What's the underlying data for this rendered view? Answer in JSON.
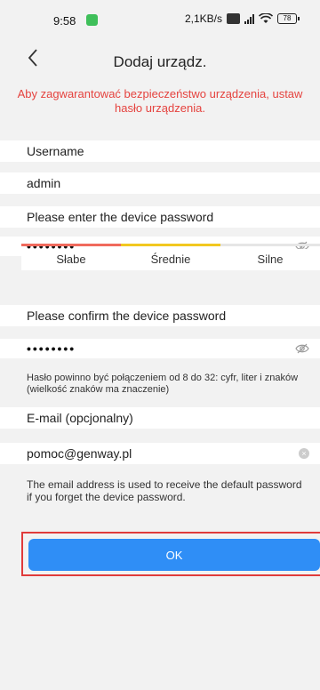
{
  "status_bar": {
    "time": "9:58",
    "network_speed": "2,1KB/s",
    "battery": "78"
  },
  "header": {
    "back_icon": "chevron-left-icon",
    "title": "Dodaj urządz."
  },
  "warning": {
    "text": "Aby zagwarantować bezpieczeństwo urządzenia, ustaw hasło urządzenia."
  },
  "username": {
    "label": "Username",
    "value": "admin"
  },
  "password": {
    "label": "Please enter the device password",
    "masked_value": "••••••••",
    "eye_icon": "eye-off-icon"
  },
  "strength": {
    "weak": "Słabe",
    "medium": "Średnie",
    "strong": "Silne",
    "colors": {
      "weak": "#f06a5d",
      "medium": "#f2c820",
      "strong": "#e6e6e6"
    }
  },
  "confirm": {
    "label": "Please confirm the device password",
    "masked_value": "••••••••",
    "eye_icon": "eye-off-icon"
  },
  "password_hint": "Hasło powinno być połączeniem od 8 do 32: cyfr, liter i znaków (wielkość znaków ma znaczenie)",
  "email": {
    "label": "E-mail (opcjonalny)",
    "value": "pomoc@genway.pl",
    "clear_icon": "clear-icon"
  },
  "email_hint": "The email address is used to receive the default password if you forget the device password.",
  "ok_button": {
    "label": "OK"
  },
  "colors": {
    "accent": "#2f8ef6",
    "warning": "#e5433f"
  }
}
